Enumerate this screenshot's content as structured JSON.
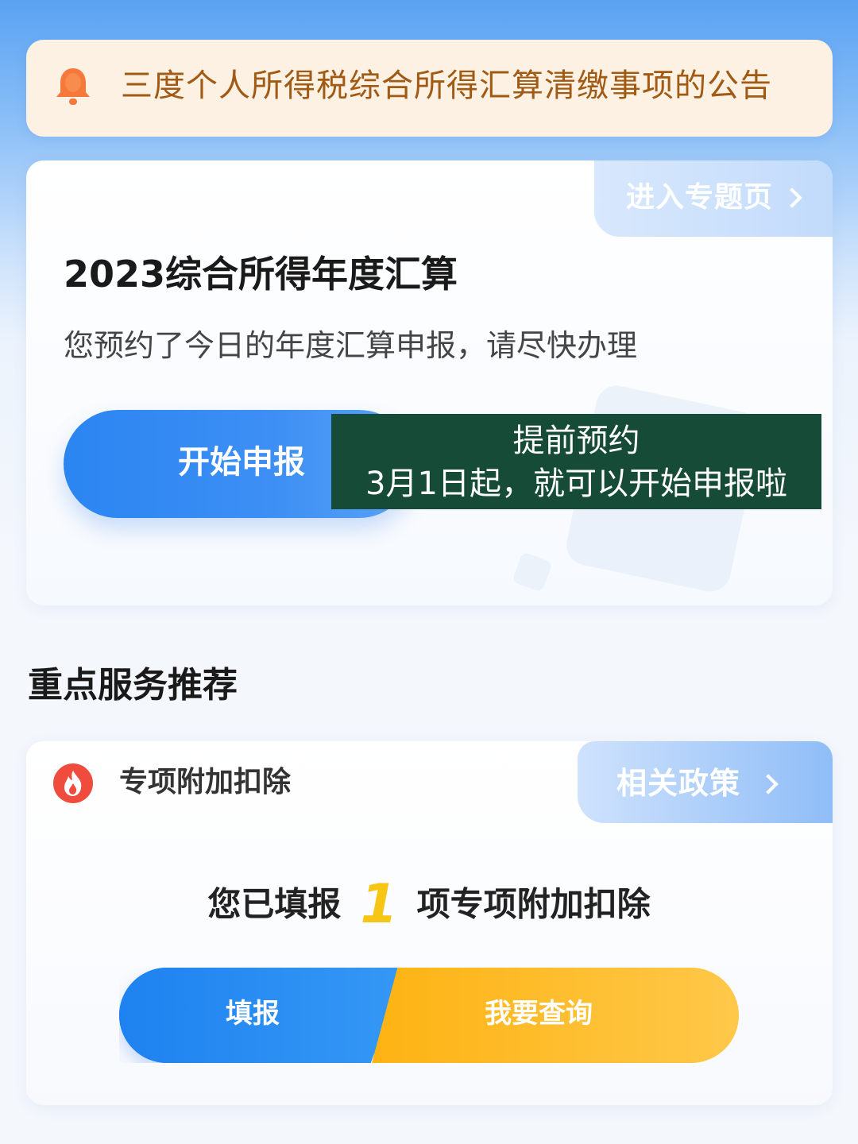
{
  "notice": {
    "icon": "bell-icon",
    "text": "三度个人所得税综合所得汇算清缴事项的公告"
  },
  "annual": {
    "topic_link": "进入专题页",
    "title": "2023综合所得年度汇算",
    "subtitle": "您预约了今日的年度汇算申报，请尽快办理",
    "start_button": "开始申报",
    "overlay_line1": "提前预约",
    "overlay_line2": "3月1日起，就可以开始申报啦"
  },
  "section_title": "重点服务推荐",
  "deduction": {
    "icon": "fire-icon",
    "label": "专项附加扣除",
    "policy_link": "相关政策",
    "filled_prefix": "您已填报",
    "filled_count": "1",
    "filled_suffix": "项专项附加扣除",
    "fill_button": "填报",
    "query_button": "我要查询"
  },
  "colors": {
    "primary_blue": "#2b85f1",
    "accent_orange": "#fdb312",
    "count_yellow": "#f7c614",
    "notice_bg": "#fdf1e3",
    "notice_text": "#a15a14",
    "overlay_bg": "#164b38"
  }
}
